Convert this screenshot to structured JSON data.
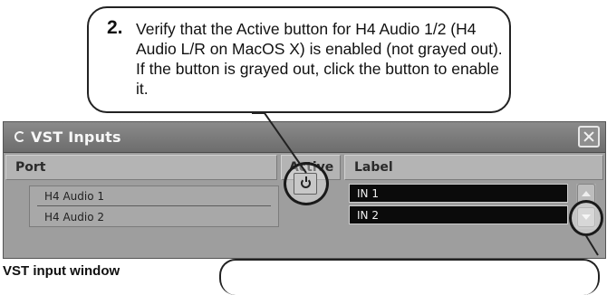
{
  "callout": {
    "step_number": "2.",
    "text": "Verify that the Active button for H4 Audio 1/2 (H4 Audio L/R on MacOS X) is enabled (not grayed out). If the button is grayed out, click the button to enable it."
  },
  "window": {
    "title": "VST Inputs",
    "headers": {
      "port": "Port",
      "active": "Active",
      "label": "Label"
    },
    "ports": [
      "H4 Audio 1",
      "H4 Audio 2"
    ],
    "labels": [
      "IN 1",
      "IN 2"
    ],
    "active_state": "enabled"
  },
  "caption": "VST input window",
  "icons": {
    "title": "vst-logo-icon",
    "close": "close-icon",
    "active": "power-icon",
    "scroll_up": "scroll-up-arrow-icon",
    "scroll_down": "scroll-down-arrow-icon"
  }
}
